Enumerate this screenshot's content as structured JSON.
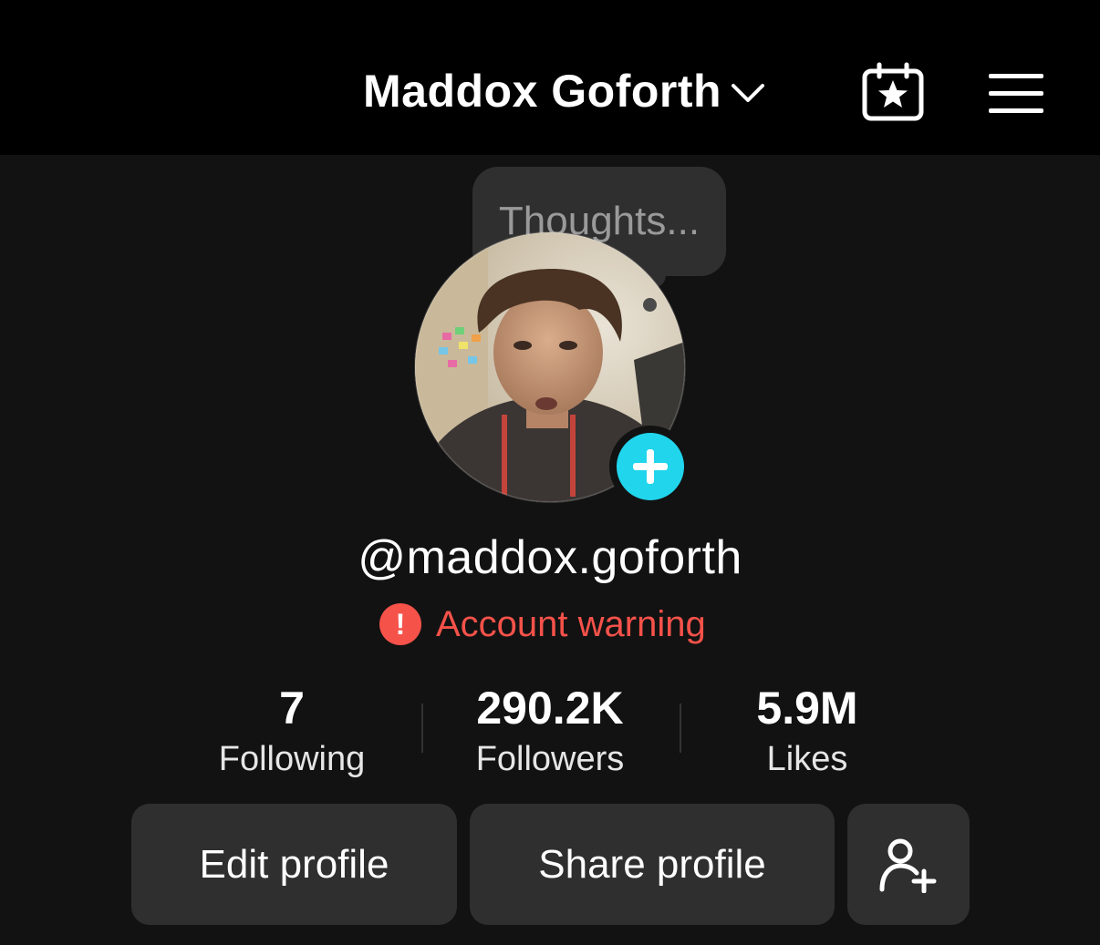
{
  "header": {
    "account_name": "Maddox Goforth",
    "icons": [
      "chevron-down-icon",
      "creator-calendar-icon",
      "hamburger-menu-icon"
    ]
  },
  "thoughts": {
    "placeholder": "Thoughts..."
  },
  "profile": {
    "username": "@maddox.goforth",
    "warning": "Account warning",
    "warning_icon": "!"
  },
  "stats": [
    {
      "value": "7",
      "label": "Following"
    },
    {
      "value": "290.2K",
      "label": "Followers"
    },
    {
      "value": "5.9M",
      "label": "Likes"
    }
  ],
  "actions": {
    "edit_profile": "Edit profile",
    "share_profile": "Share profile"
  },
  "colors": {
    "background": "#121212",
    "topbar": "#000000",
    "accent_cyan": "#20d5ec",
    "warning_red": "#f5524a",
    "button_bg": "#2f2f2f"
  }
}
